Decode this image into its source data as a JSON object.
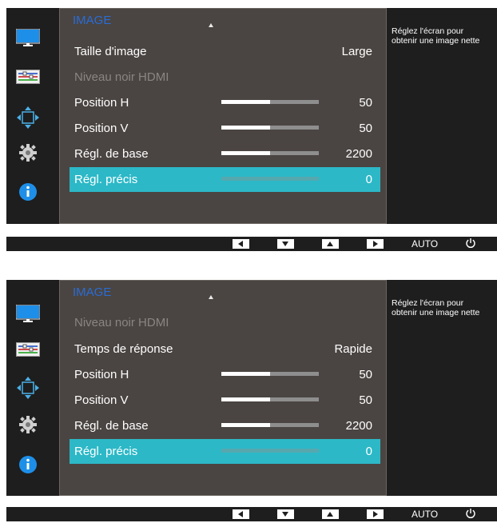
{
  "screen_a": {
    "menu_title": "IMAGE",
    "rows": [
      {
        "label": "Taille d'image",
        "value": "Large"
      },
      {
        "label": "Niveau noir HDMI",
        "value": ""
      },
      {
        "label": "Position H",
        "value": "50",
        "level": 0.5
      },
      {
        "label": "Position V",
        "value": "50",
        "level": 0.5
      },
      {
        "label": "Régl. de base",
        "value": "2200",
        "level": 0.5
      },
      {
        "label": "Régl. précis",
        "value": "0",
        "level": 0
      }
    ],
    "help_line1": "Réglez l'écran pour",
    "help_line2": "obtenir une image nette",
    "auto_label": "AUTO"
  },
  "screen_b": {
    "menu_title": "IMAGE",
    "rows": [
      {
        "label": "Niveau noir HDMI",
        "value": ""
      },
      {
        "label": "Temps de réponse",
        "value": "Rapide"
      },
      {
        "label": "Position H",
        "value": "50",
        "level": 0.5
      },
      {
        "label": "Position V",
        "value": "50",
        "level": 0.5
      },
      {
        "label": "Régl. de base",
        "value": "2200",
        "level": 0.5
      },
      {
        "label": "Régl. précis",
        "value": "0",
        "level": 0
      }
    ],
    "help_line1": "Réglez l'écran pour",
    "help_line2": "obtenir une image nette",
    "auto_label": "AUTO"
  },
  "colors": {
    "accent_selected": "#2cb8c7",
    "menu_title": "#2a6cd6",
    "menu_bg": "#4a4542",
    "disabled_text": "#8a8582"
  },
  "icons": [
    "monitor-icon",
    "color-adjust-icon",
    "position-arrows-icon",
    "gear-icon",
    "info-icon",
    "arrow-left-icon",
    "arrow-down-icon",
    "arrow-up-icon",
    "arrow-right-icon",
    "power-icon"
  ]
}
